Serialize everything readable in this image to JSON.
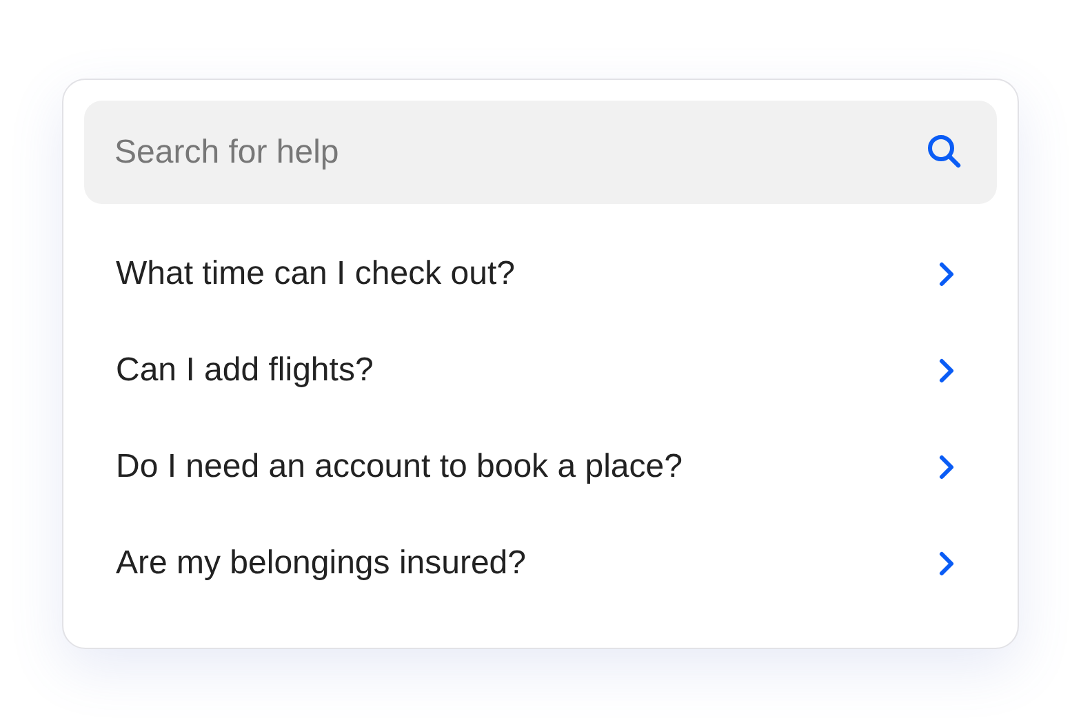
{
  "search": {
    "placeholder": "Search for help"
  },
  "questions": [
    {
      "label": "What time can I check out?"
    },
    {
      "label": "Can I add flights?"
    },
    {
      "label": "Do I need an account to book a place?"
    },
    {
      "label": "Are my belongings insured?"
    }
  ]
}
